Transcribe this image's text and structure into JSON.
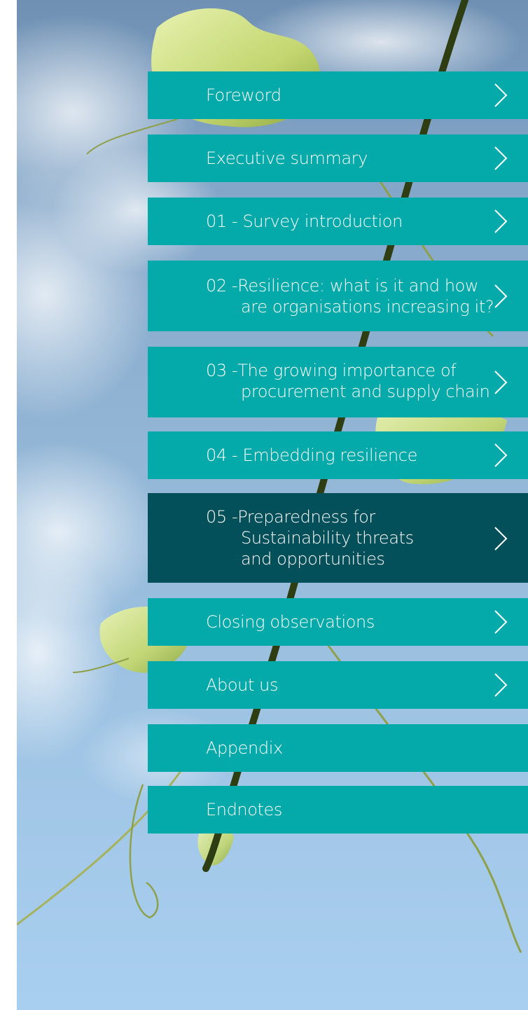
{
  "colors": {
    "item_bg": "#04a9a9",
    "item_active_bg": "#034f5a",
    "text": "#ffffff"
  },
  "nav": {
    "items": [
      {
        "label": "Foreword",
        "has_chevron": true,
        "active": false
      },
      {
        "label": "Executive summary",
        "has_chevron": true,
        "active": false
      },
      {
        "label": "01 - Survey introduction",
        "has_chevron": true,
        "active": false
      },
      {
        "num": "02 - ",
        "line1": "Resilience: what is it and how",
        "line2": "are organisations increasing it?",
        "has_chevron": true,
        "active": false
      },
      {
        "num": "03 - ",
        "line1": "The growing importance of",
        "line2": "procurement and supply chain",
        "has_chevron": true,
        "active": false
      },
      {
        "label": "04 - Embedding resilience",
        "has_chevron": true,
        "active": false
      },
      {
        "num": "05 - ",
        "line1": "Preparedness for",
        "line2": "Sustainability threats",
        "line3": "and opportunities",
        "has_chevron": true,
        "active": true
      },
      {
        "label": "Closing observations",
        "has_chevron": true,
        "active": false
      },
      {
        "label": "About us",
        "has_chevron": true,
        "active": false
      },
      {
        "label": "Appendix",
        "has_chevron": false,
        "active": false
      },
      {
        "label": "Endnotes",
        "has_chevron": false,
        "active": false
      }
    ]
  },
  "icons": {
    "chevron": "chevron-right-icon",
    "background": "vine-leaf-sky-photo"
  }
}
